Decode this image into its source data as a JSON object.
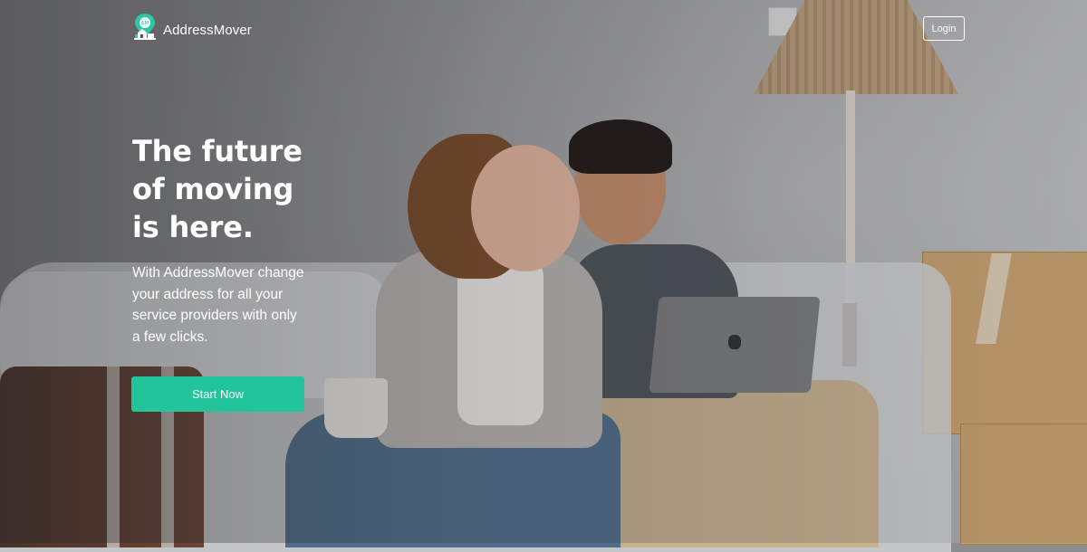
{
  "nav": {
    "brand": {
      "name": "AddressMover",
      "logo_text": "AM"
    },
    "login_label": "Login"
  },
  "hero": {
    "title_lines": [
      "The future",
      "of moving",
      "is here."
    ],
    "subtitle": "With AddressMover change your address for all your service providers with only a few clicks.",
    "cta_label": "Start Now"
  },
  "colors": {
    "accent": "#22c59b",
    "text": "#ffffff",
    "logo_pin": "#2cc6a8"
  },
  "icons": {
    "logo": "house-location-pin-icon",
    "laptop_logo": "apple-logo-icon"
  }
}
